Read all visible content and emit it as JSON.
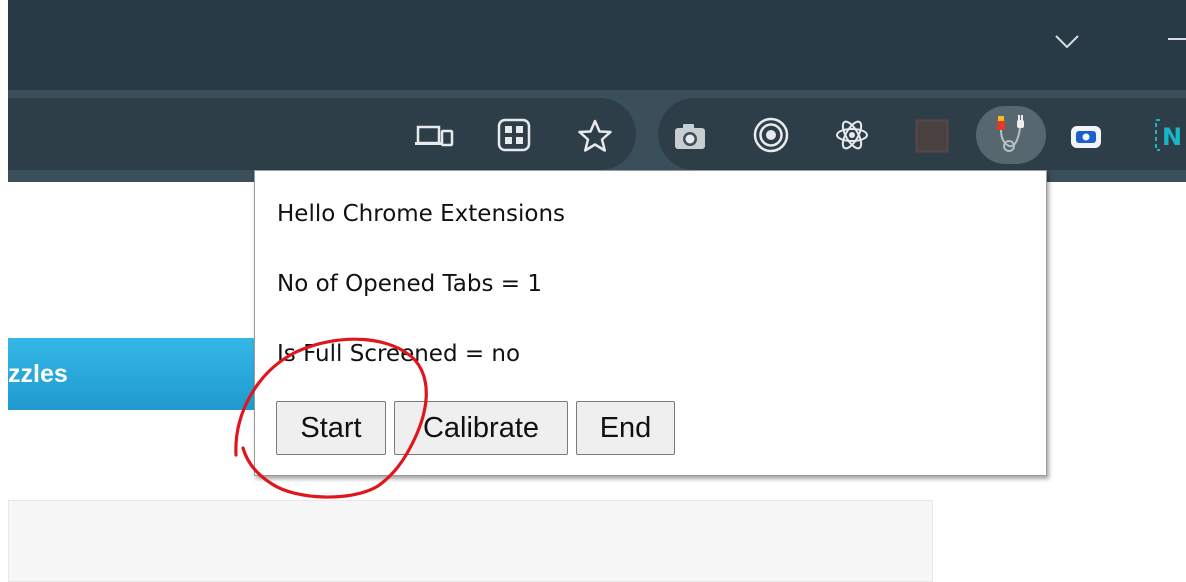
{
  "browser": {
    "colors": {
      "tab_strip": "#283a45",
      "toolbar": "#3b4f5b",
      "omnibox": "#2d3e49"
    },
    "toolbar_icons": [
      "cast-icon",
      "tab-grid-icon",
      "bookmark-star-icon",
      "camera-extension-icon",
      "target-extension-icon",
      "react-devtools-icon",
      "extension-dark-icon",
      "plugin-extension-icon",
      "screen-record-icon",
      "n-extension-icon"
    ]
  },
  "page": {
    "banner_text": "zzles",
    "banner_color": "#1f9ad0"
  },
  "popup": {
    "title": "Hello Chrome Extensions",
    "tabs_line": "No of Opened Tabs = 1",
    "fullscreen_line": "Is Full Screened = no",
    "buttons": {
      "start": "Start",
      "calibrate": "Calibrate",
      "end": "End"
    }
  },
  "annotation": {
    "color": "#e0161d",
    "shape": "freehand-circle"
  }
}
